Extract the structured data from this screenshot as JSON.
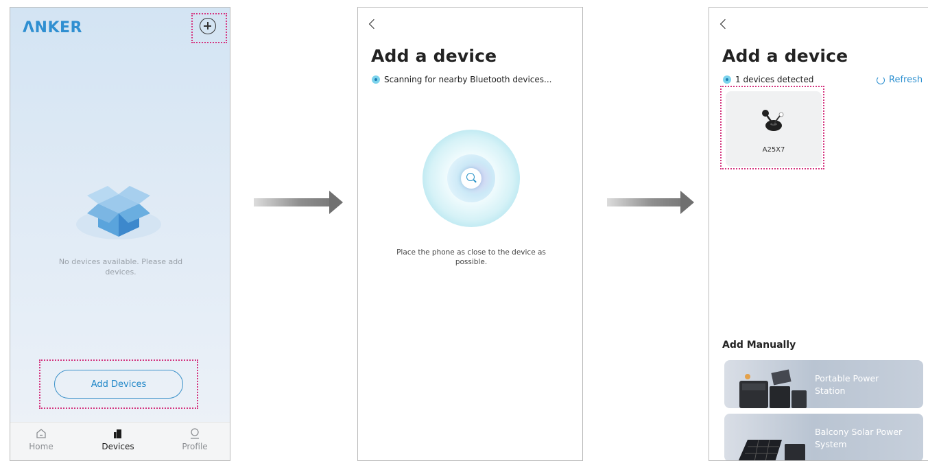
{
  "screen1": {
    "logo": "ΛNKER",
    "empty_message": "No devices available. Please add devices.",
    "add_devices_label": "Add Devices",
    "nav": [
      {
        "label": "Home",
        "icon": "home-icon",
        "active": false
      },
      {
        "label": "Devices",
        "icon": "devices-icon",
        "active": true
      },
      {
        "label": "Profile",
        "icon": "profile-icon",
        "active": false
      }
    ]
  },
  "screen2": {
    "title": "Add a device",
    "status": "Scanning for nearby Bluetooth devices...",
    "hint": "Place the phone as close to the device as possible."
  },
  "screen3": {
    "title": "Add a device",
    "status": "1 devices detected",
    "refresh_label": "Refresh",
    "device_name": "A25X7",
    "manual_title": "Add Manually",
    "manual_items": [
      {
        "label": "Portable Power Station"
      },
      {
        "label": "Balcony Solar Power System"
      }
    ]
  },
  "colors": {
    "accent": "#2b8fd0",
    "highlight_dash": "#d4357f",
    "card_bg": "#f0f1f2"
  }
}
